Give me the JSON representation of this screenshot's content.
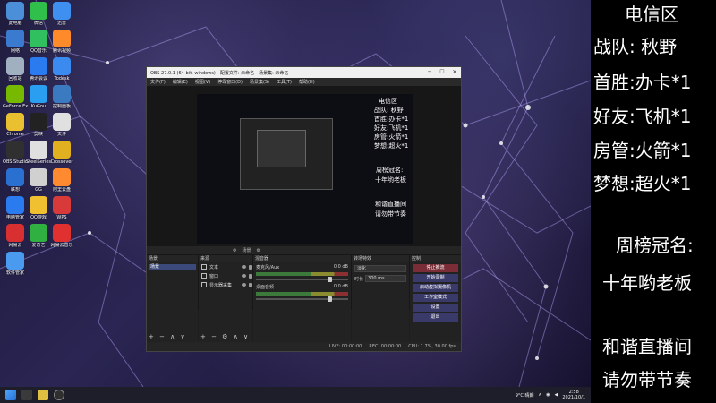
{
  "desktop_icons": [
    {
      "label": "此电脑",
      "icon": "computer-icon",
      "color": "#4a8fd8"
    },
    {
      "label": "微信",
      "icon": "wechat-icon",
      "color": "#2fbf4a"
    },
    {
      "label": "迅雷",
      "icon": "thunder-icon",
      "color": "#3f8ff0"
    },
    {
      "label": "网络",
      "icon": "network-icon",
      "color": "#3a7bd0"
    },
    {
      "label": "QQ音乐",
      "icon": "qq-music-icon",
      "color": "#30c060"
    },
    {
      "label": "腾讯视频",
      "icon": "tencent-video-icon",
      "color": "#ff8a2a"
    },
    {
      "label": "回收站",
      "icon": "recycle-bin-icon",
      "color": "#a0b0c0"
    },
    {
      "label": "腾讯会议",
      "icon": "tencent-meeting-icon",
      "color": "#2a7bf0"
    },
    {
      "label": "Todesk",
      "icon": "todesk-icon",
      "color": "#3a8af0"
    },
    {
      "label": "GeForce Experience",
      "icon": "geforce-icon",
      "color": "#76b900"
    },
    {
      "label": "KuGou",
      "icon": "kugou-icon",
      "color": "#2a9ef0"
    },
    {
      "label": "控制面板",
      "icon": "control-panel-icon",
      "color": "#3a7ac0"
    },
    {
      "label": "Chrome",
      "icon": "chrome-icon",
      "color": "#e8c030"
    },
    {
      "label": "剪映",
      "icon": "capcut-icon",
      "color": "#222222"
    },
    {
      "label": "文件",
      "icon": "file-icon",
      "color": "#e0e0e0"
    },
    {
      "label": "OBS Studio",
      "icon": "obs-icon",
      "color": "#303030"
    },
    {
      "label": "SteelSeries",
      "icon": "steelseries-icon",
      "color": "#e0e0e0"
    },
    {
      "label": "Crossover",
      "icon": "crossover-icon",
      "color": "#e0b020"
    },
    {
      "label": "联想",
      "icon": "lenovo-icon",
      "color": "#2a70d0"
    },
    {
      "label": "GG",
      "icon": "gg-icon",
      "color": "#d0d0d0"
    },
    {
      "label": "阿里云盘",
      "icon": "aliyun-icon",
      "color": "#ff8a30"
    },
    {
      "label": "电脑管家",
      "icon": "pc-manager-icon",
      "color": "#2a7af0"
    },
    {
      "label": "QQ游戏",
      "icon": "qq-game-icon",
      "color": "#f0c030"
    },
    {
      "label": "WPS",
      "icon": "wps-icon",
      "color": "#d83a3a"
    },
    {
      "label": "网易云",
      "icon": "netease-icon",
      "color": "#d83030"
    },
    {
      "label": "爱奇艺",
      "icon": "iqiyi-icon",
      "color": "#30b040"
    },
    {
      "label": "网易云音乐",
      "icon": "netease-music-icon",
      "color": "#e03030"
    },
    {
      "label": "软件管家",
      "icon": "software-icon",
      "color": "#4a9af0"
    }
  ],
  "obs": {
    "title": "OBS 27.0.1 (64-bit, windows) - 配置文件: 未命名 - 场景集: 未命名",
    "menu": [
      "文件(F)",
      "编辑(E)",
      "视图(V)",
      "停靠窗口(D)",
      "场景集(S)",
      "工具(T)",
      "帮助(H)"
    ],
    "scene_bar_label": "场景",
    "docks": {
      "scenes_title": "场景",
      "sources_title": "来源",
      "mixer_title": "混音器",
      "transition_title": "转场特效",
      "controls_title": "控制"
    },
    "scenes": [
      "场景"
    ],
    "sources": [
      {
        "label": "文本",
        "icon": "text-icon"
      },
      {
        "label": "窗口",
        "icon": "window-icon"
      },
      {
        "label": "显示器采集",
        "icon": "monitor-icon"
      }
    ],
    "mixer": [
      {
        "name": "麦克风/Aux",
        "db": "0.0 dB"
      },
      {
        "name": "桌面音频",
        "db": "0.0 dB"
      }
    ],
    "transition": {
      "type": "淡化",
      "duration_label": "时长",
      "duration": "300 ms"
    },
    "controls": [
      "停止推流",
      "开始录制",
      "启动虚拟摄像机",
      "工作室模式",
      "设置",
      "退出"
    ],
    "status": {
      "live": "LIVE: 00:00:00",
      "rec": "REC: 00:00:00",
      "cpu": "CPU: 1.7%, 30.00 fps"
    }
  },
  "overlay": {
    "lines": [
      "电信区",
      "战队:  秋野",
      "首胜:办卡*1",
      "好友:飞机*1",
      "房管:火箭*1",
      "梦想:超火*1"
    ],
    "ranking_label": "周榜冠名:",
    "ranking_value": "十年哟老板",
    "notice": [
      "和谐直播间",
      "请勿带节奏"
    ]
  },
  "taskbar": {
    "weather": "9°C 晴朗",
    "time": "2:58",
    "date": "2021/10/1"
  }
}
